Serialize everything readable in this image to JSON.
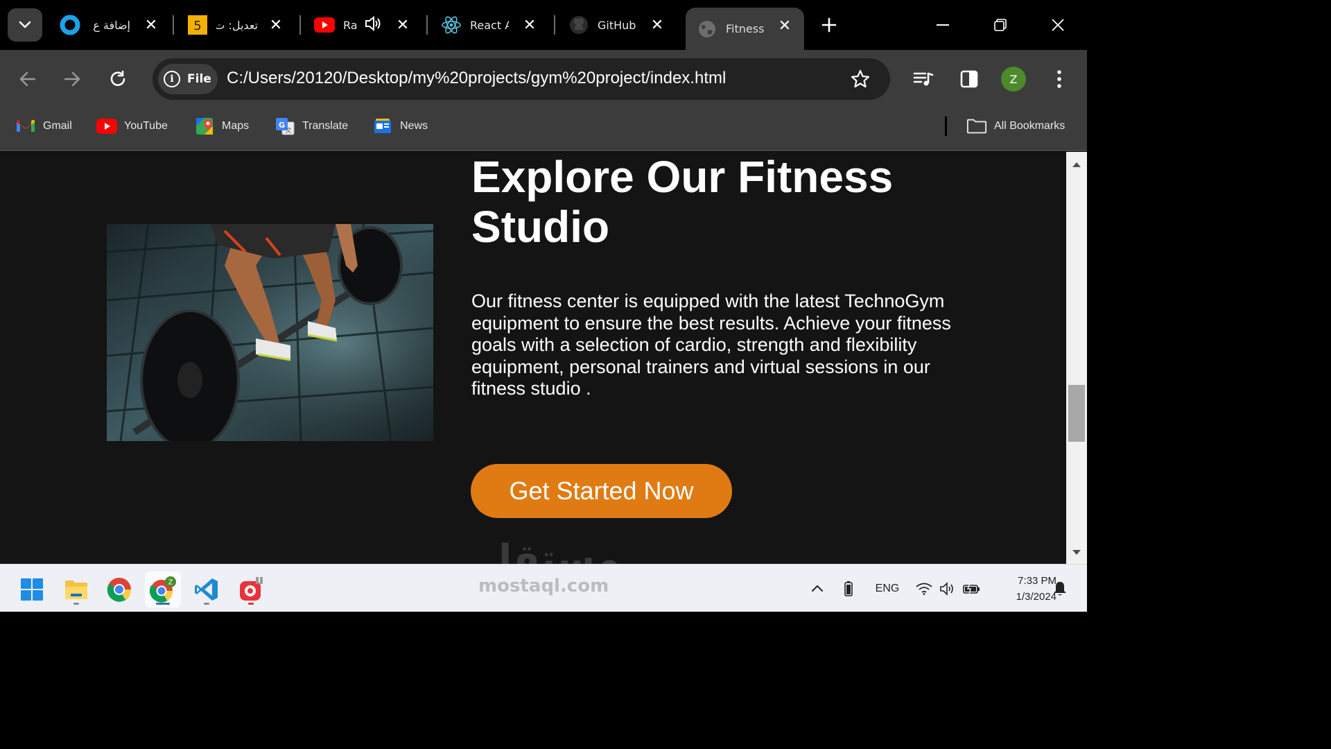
{
  "tabs": [
    {
      "title": "إضافة ع",
      "icon": "blue-ring-icon",
      "active": false
    },
    {
      "title": "تعديل: ت",
      "icon": "five-badge-icon",
      "active": false
    },
    {
      "title": "Ra",
      "icon": "youtube-icon",
      "active": false,
      "audio": true
    },
    {
      "title": "React A",
      "icon": "react-icon",
      "active": false
    },
    {
      "title": "GitHub",
      "icon": "github-icon",
      "active": false
    },
    {
      "title": "Fitness",
      "icon": "globe-icon",
      "active": true
    }
  ],
  "address_bar": {
    "chip_label": "File",
    "url": "C:/Users/20120/Desktop/my%20projects/gym%20project/index.html"
  },
  "profile": {
    "initial": "Z",
    "color": "#4c8a2a"
  },
  "bookmarks": [
    {
      "label": "Gmail",
      "icon": "gmail-icon"
    },
    {
      "label": "YouTube",
      "icon": "youtube-icon"
    },
    {
      "label": "Maps",
      "icon": "maps-icon"
    },
    {
      "label": "Translate",
      "icon": "translate-icon"
    },
    {
      "label": "News",
      "icon": "news-icon"
    }
  ],
  "all_bookmarks_label": "All Bookmarks",
  "page": {
    "heading": "Explore Our Fitness Studio",
    "description": "Our fitness center is equipped with the latest TechnoGym equipment to ensure the best results. Achieve your fitness goals with a selection of cardio, strength and flexibility equipment, personal trainers and virtual sessions in our fitness studio .",
    "cta_label": "Get Started Now",
    "accent_color": "#e07b13",
    "background_color": "#141414"
  },
  "watermark": {
    "arabic": "مستقل",
    "latin": "mostaql.com"
  },
  "taskbar": {
    "apps": [
      "windows-start-icon",
      "file-explorer-icon",
      "chrome-icon",
      "chrome-profile-icon",
      "vscode-icon",
      "screen-recorder-icon"
    ],
    "language": "ENG",
    "time": "7:33 PM",
    "date": "1/3/2024"
  }
}
